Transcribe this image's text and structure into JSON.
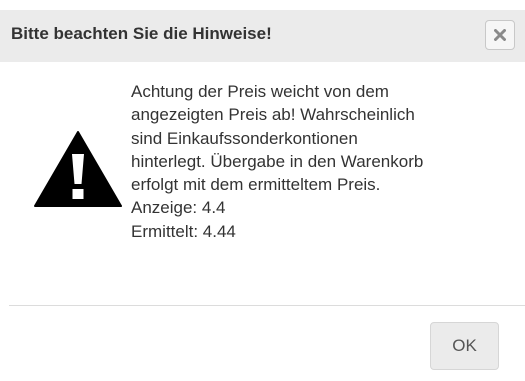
{
  "dialog": {
    "title": "Bitte beachten Sie die Hinweise!",
    "close_icon": "close-icon",
    "warning_icon": "warning-triangle-icon",
    "message_lines": [
      "Achtung der Preis weicht von dem",
      "angezeigten Preis ab! Wahrscheinlich",
      "sind Einkaufssonderkontionen",
      "hinterlegt. Übergabe in den Warenkorb",
      "erfolgt mit dem ermitteltem Preis.",
      "Anzeige: 4.4",
      "Ermittelt: 4.44"
    ],
    "ok_label": "OK"
  },
  "colors": {
    "header_background": "#ebebeb",
    "text": "#333333",
    "icon": "#000000",
    "button_background": "#ebebeb"
  }
}
